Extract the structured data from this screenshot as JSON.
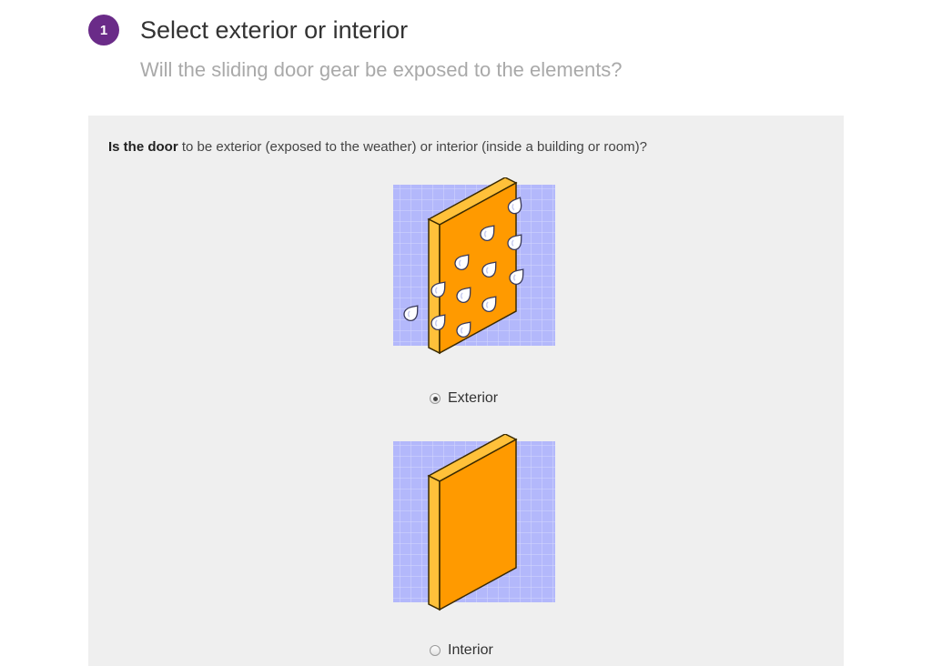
{
  "step": {
    "number": "1",
    "title": "Select exterior or interior",
    "subtitle": "Will the sliding door gear be exposed to the elements?"
  },
  "question": {
    "bold": "Is the door",
    "rest": " to be exterior (exposed to the weather) or interior (inside a building or room)?"
  },
  "options": [
    {
      "label": "Exterior",
      "selected": true
    },
    {
      "label": "Interior",
      "selected": false
    }
  ],
  "colors": {
    "accent": "#6a2b88",
    "door": "#ff9a00",
    "door_edge": "#ffc13a",
    "grid_bg": "#b3b8fb",
    "panel_bg": "#efefef"
  }
}
